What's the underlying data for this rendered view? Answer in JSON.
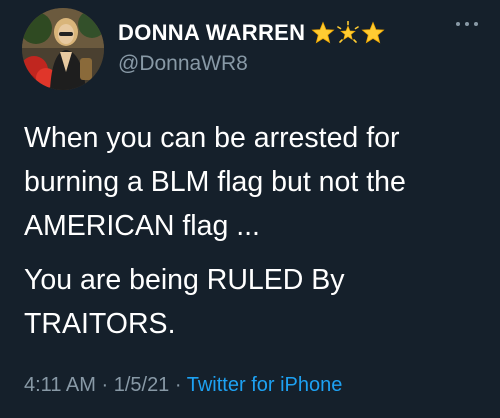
{
  "author": {
    "display_name": "DONNA WARREN",
    "handle": "@DonnaWR8",
    "name_emojis": [
      "star",
      "glowing-star",
      "star"
    ]
  },
  "tweet": {
    "paragraphs": [
      "When you can be arrested for\nburning a BLM flag but not the\nAMERICAN flag ...",
      "You are being RULED By\nTRAITORS."
    ],
    "time": "4:11 AM",
    "date": "1/5/21",
    "separator": "·",
    "source": "Twitter for iPhone"
  },
  "colors": {
    "background": "#15202b",
    "text": "#ffffff",
    "secondary": "#8899a6",
    "link": "#1da1f2"
  }
}
